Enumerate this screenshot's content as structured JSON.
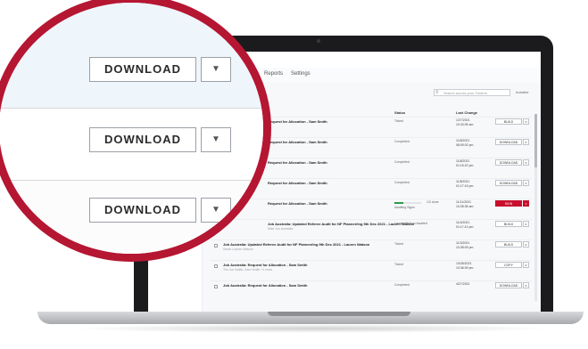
{
  "colors": {
    "accent": "#c8102e",
    "ring": "#b51632",
    "progress": "#2e9b4b"
  },
  "app": {
    "tabs": [
      "Reports",
      "Settings"
    ],
    "search_placeholder": "Search across your Folders",
    "toggle_label": "Invisible",
    "columns": {
      "status": "Status",
      "last_change": "Last Change"
    }
  },
  "rows": [
    {
      "title": "Request for Allocation - Sam Smith",
      "sub": "",
      "status": "Ticked",
      "date": "12/7/2021",
      "time": "10:43:05 am",
      "action": "BUILD",
      "checkbox": false
    },
    {
      "title": "Request for Allocation - Sam Smith",
      "sub": "",
      "status": "Completed",
      "date": "11/8/2021",
      "time": "08:09:02 pm",
      "action": "DOWNLOAD",
      "checkbox": false
    },
    {
      "title": "Request for Allocation - Sam Smith",
      "sub": "",
      "status": "Completed",
      "date": "11/8/2021",
      "time": "01:15:22 pm",
      "action": "DOWNLOAD",
      "checkbox": false
    },
    {
      "title": "Request for Allocation - Sam Smith",
      "sub": "",
      "status": "Completed",
      "date": "11/8/2021",
      "time": "01:17:15 pm",
      "action": "DOWNLOAD",
      "checkbox": false
    },
    {
      "title": "Request for Allocation - Sam Smith",
      "sub": "",
      "status": "Awaiting Signs",
      "progress_label": "1/3 done",
      "progress": 0.33,
      "date": "11/11/2021",
      "time": "10:28:35 am",
      "action": "SIGN",
      "checkbox": false
    },
    {
      "title": "Job Australia: Updated Referee Audit for NF Planner/ing 9th Dec 2021 - Lauren Watson",
      "sub": "Mike Jon Australia",
      "status": "Lauren Watson Awaited",
      "date": "11/4/2021",
      "time": "01:17:14 pm",
      "action": "BUILD",
      "checkbox": false
    },
    {
      "title": "Job Australia: Updated Referee Audit for NF Planner/ing 9th Dec 2021 - Lauren Watson",
      "sub": "Sarah Lauren Watson",
      "status": "Ticked",
      "date": "11/3/2021",
      "time": "10:38:09 pm",
      "action": "BUILD",
      "checkbox": true
    },
    {
      "title": "Job Australia: Request for Allocation - Sam Smith",
      "sub": "Tim Jon Smith, Sam Smith +1 more",
      "status": "Ticked",
      "date": "10/28/2021",
      "time": "10:36:09 pm",
      "action": "COPY",
      "checkbox": true
    },
    {
      "title": "Job Australia: Request for Allocation - Sam Smith",
      "sub": "",
      "status": "Completed",
      "date": "4/27/2021",
      "time": "",
      "action": "DOWNLOAD",
      "checkbox": true
    }
  ],
  "magnifier": {
    "buttons": [
      {
        "label": "DOWNLOAD",
        "caret": "▼"
      },
      {
        "label": "DOWNLOAD",
        "caret": "▼"
      },
      {
        "label": "DOWNLOAD",
        "caret": "▼"
      }
    ]
  }
}
